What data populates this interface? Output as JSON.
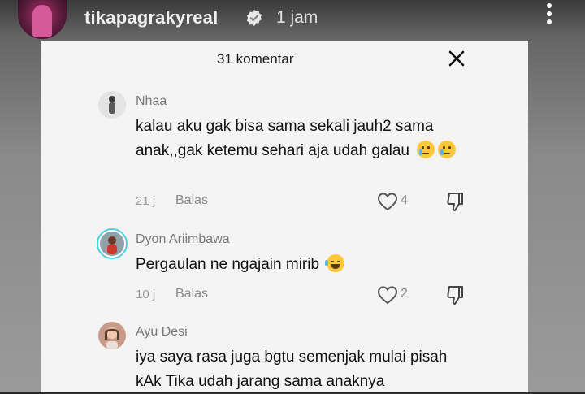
{
  "story": {
    "username": "tikapagrakyreal",
    "time": "1 jam"
  },
  "panel": {
    "title": "31 komentar"
  },
  "comments": [
    {
      "name": "Nhaa",
      "text": "kalau aku gak bisa sama sekali jauh2 sama anak,,gak ketemu sehari aja udah galau",
      "emojis": [
        "sad-tear-emoji",
        "sad-tear-emoji"
      ],
      "time": "21 j",
      "reply": "Balas",
      "likes": "4"
    },
    {
      "name": "Dyon Ariimbawa",
      "text": "Pergaulan ne ngajain mirib",
      "emojis": [
        "laughing-tears-emoji"
      ],
      "time": "10 j",
      "reply": "Balas",
      "likes": "2"
    },
    {
      "name": "Ayu Desi",
      "text": "iya saya rasa juga bgtu semenjak mulai pisah kAk Tika udah jarang sama anaknya"
    }
  ],
  "colors": {
    "panel_bg": "#f4f4f4",
    "name_gray": "#7a7a7a",
    "meta_gray": "#8a8a8a",
    "ring_cyan": "#4fd0e0"
  }
}
